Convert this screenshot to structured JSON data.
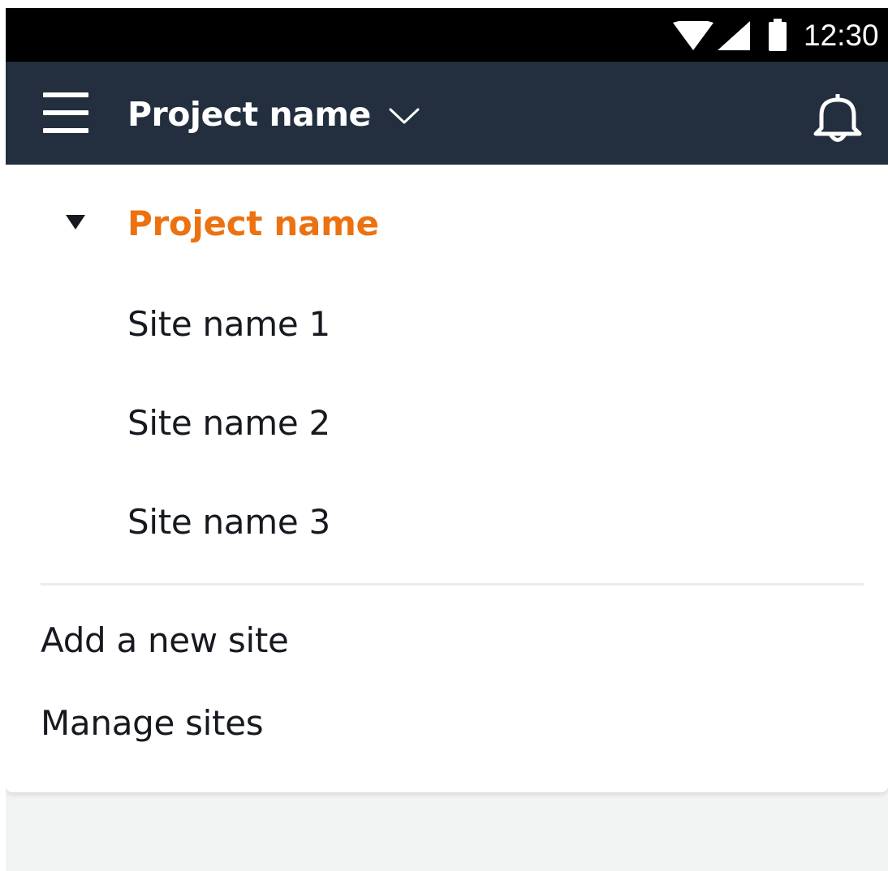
{
  "status_bar": {
    "time": "12:30",
    "icons": [
      "wifi-icon",
      "cell-signal-icon",
      "battery-icon"
    ]
  },
  "header": {
    "menu_icon": "hamburger-menu-icon",
    "project_title": "Project name",
    "switcher_icon": "chevron-down-icon",
    "notification_icon": "bell-icon"
  },
  "dropdown": {
    "project": {
      "label": "Project name",
      "expanded_icon": "caret-down-icon"
    },
    "sites": [
      {
        "label": "Site name 1"
      },
      {
        "label": "Site name 2"
      },
      {
        "label": "Site name 3"
      }
    ],
    "actions": [
      {
        "label": "Add a new site"
      },
      {
        "label": "Manage sites"
      }
    ]
  },
  "colors": {
    "header_bg": "#232f3e",
    "status_bar_bg": "#000000",
    "accent": "#ec7211",
    "text": "#16191f",
    "page_bg": "#f2f3f3",
    "divider": "#e9ebed"
  }
}
